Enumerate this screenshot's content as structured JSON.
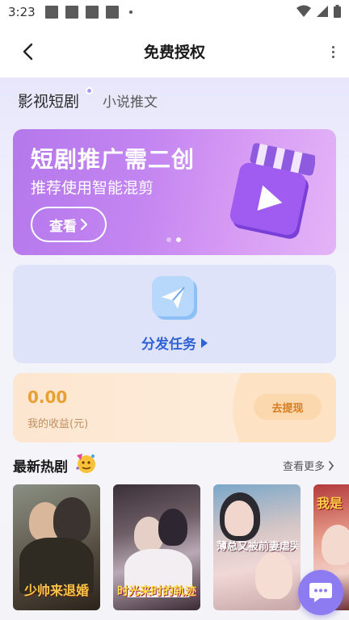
{
  "status_bar": {
    "time": "3:23"
  },
  "app_bar": {
    "title": "免费授权"
  },
  "tabs": [
    {
      "label": "影视短剧",
      "active": true
    },
    {
      "label": "小说推文",
      "active": false
    }
  ],
  "banner": {
    "title": "短剧推广需二创",
    "subtitle": "推荐使用智能混剪",
    "button_label": "查看",
    "page_count": 2,
    "active_page": 2
  },
  "distribute": {
    "label": "分发任务"
  },
  "earnings": {
    "value": "0.00",
    "label": "我的收益(元)",
    "withdraw_label": "去提现"
  },
  "hot_dramas": {
    "title": "最新热剧",
    "see_more": "查看更多",
    "posters": [
      {
        "title": "少帅来退婚"
      },
      {
        "title": "时光来时的轨迹"
      },
      {
        "title": "薄总又被前妻虐哭了"
      },
      {
        "title": "我是"
      }
    ]
  },
  "colors": {
    "accent": "#8d7bf2",
    "banner": "#c385f0",
    "distribute_text": "#2f62d6",
    "earnings_value": "#e8a033"
  },
  "icons": [
    "back-arrow-icon",
    "more-vertical-icon",
    "play-clapper-icon",
    "paper-plane-icon",
    "party-emoji-icon",
    "chevron-right-icon",
    "chat-bubble-icon"
  ]
}
